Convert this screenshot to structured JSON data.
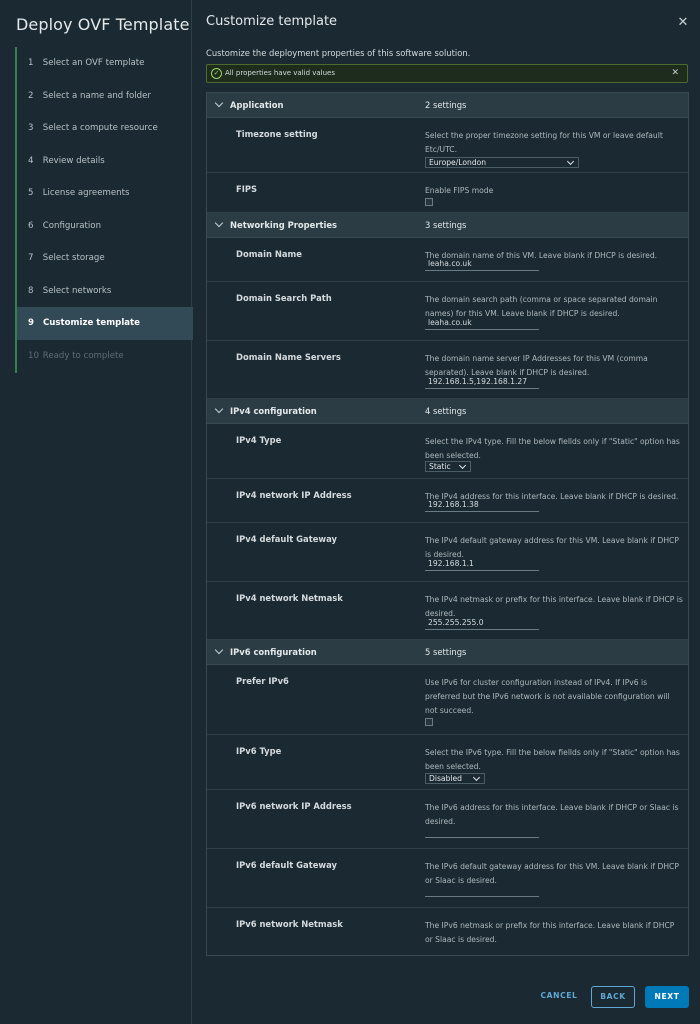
{
  "sidebar": {
    "title": "Deploy OVF Template",
    "steps": [
      {
        "num": "1",
        "label": "Select an OVF template"
      },
      {
        "num": "2",
        "label": "Select a name and folder"
      },
      {
        "num": "3",
        "label": "Select a compute resource"
      },
      {
        "num": "4",
        "label": "Review details"
      },
      {
        "num": "5",
        "label": "License agreements"
      },
      {
        "num": "6",
        "label": "Configuration"
      },
      {
        "num": "7",
        "label": "Select storage"
      },
      {
        "num": "8",
        "label": "Select networks"
      },
      {
        "num": "9",
        "label": "Customize template"
      },
      {
        "num": "10",
        "label": "Ready to complete"
      }
    ],
    "active_step": 9
  },
  "main": {
    "title": "Customize template",
    "subtitle": "Customize the deployment properties of this software solution.",
    "alert": "All properties have valid values"
  },
  "groups": {
    "application": {
      "name": "Application",
      "count": "2 settings",
      "timezone": {
        "name": "Timezone setting",
        "desc": "Select the proper timezone setting for this VM or leave default Etc/UTC.",
        "value": "Europe/London"
      },
      "fips": {
        "name": "FIPS",
        "desc": "Enable FIPS mode",
        "checked": false
      }
    },
    "networking": {
      "name": "Networking Properties",
      "count": "3 settings",
      "domain_name": {
        "name": "Domain Name",
        "desc": "The domain name of this VM. Leave blank if DHCP is desired.",
        "value": "leaha.co.uk"
      },
      "search_path": {
        "name": "Domain Search Path",
        "desc": "The domain search path (comma or space separated domain names) for this VM. Leave blank if DHCP is desired.",
        "value": "leaha.co.uk"
      },
      "dns": {
        "name": "Domain Name Servers",
        "desc": "The domain name server IP Addresses for this VM (comma separated). Leave blank if DHCP is desired.",
        "value": "192.168.1.5,192.168.1.27"
      }
    },
    "ipv4": {
      "name": "IPv4 configuration",
      "count": "4 settings",
      "type": {
        "name": "IPv4 Type",
        "desc": "Select the IPv4 type. Fill the below fiellds only if \"Static\" option has been selected.",
        "value": "Static"
      },
      "ip": {
        "name": "IPv4 network IP Address",
        "desc": "The IPv4 address for this interface. Leave blank if DHCP is desired.",
        "value": "192.168.1.38"
      },
      "gateway": {
        "name": "IPv4 default Gateway",
        "desc": "The IPv4 default gateway address for this VM. Leave blank if DHCP is desired.",
        "value": "192.168.1.1"
      },
      "netmask": {
        "name": "IPv4 network Netmask",
        "desc": "The IPv4 netmask or prefix for this interface. Leave blank if DHCP is desired.",
        "value": "255.255.255.0"
      }
    },
    "ipv6": {
      "name": "IPv6 configuration",
      "count": "5 settings",
      "prefer": {
        "name": "Prefer IPv6",
        "desc": "Use IPv6 for cluster configuration instead of IPv4. If IPv6 is preferred but the IPv6 network is not available configuration will not succeed.",
        "checked": false
      },
      "type": {
        "name": "IPv6 Type",
        "desc": "Select the IPv6 type. Fill the below fiellds only if \"Static\" option has been selected.",
        "value": "Disabled"
      },
      "ip": {
        "name": "IPv6 network IP Address",
        "desc": "The IPv6 address for this interface. Leave blank if DHCP or Slaac is desired.",
        "value": ""
      },
      "gateway": {
        "name": "IPv6 default Gateway",
        "desc": "The IPv6 default gateway address for this VM. Leave blank if DHCP or Slaac is desired.",
        "value": ""
      },
      "netmask": {
        "name": "IPv6 network Netmask",
        "desc": "The IPv6 netmask or prefix for this interface. Leave blank if DHCP or Slaac is desired.",
        "value": ""
      }
    }
  },
  "footer": {
    "cancel": "CANCEL",
    "back": "BACK",
    "next": "NEXT"
  },
  "colors": {
    "accent": "#0079b8",
    "link": "#5fa8d3",
    "success": "#9bd36a"
  }
}
